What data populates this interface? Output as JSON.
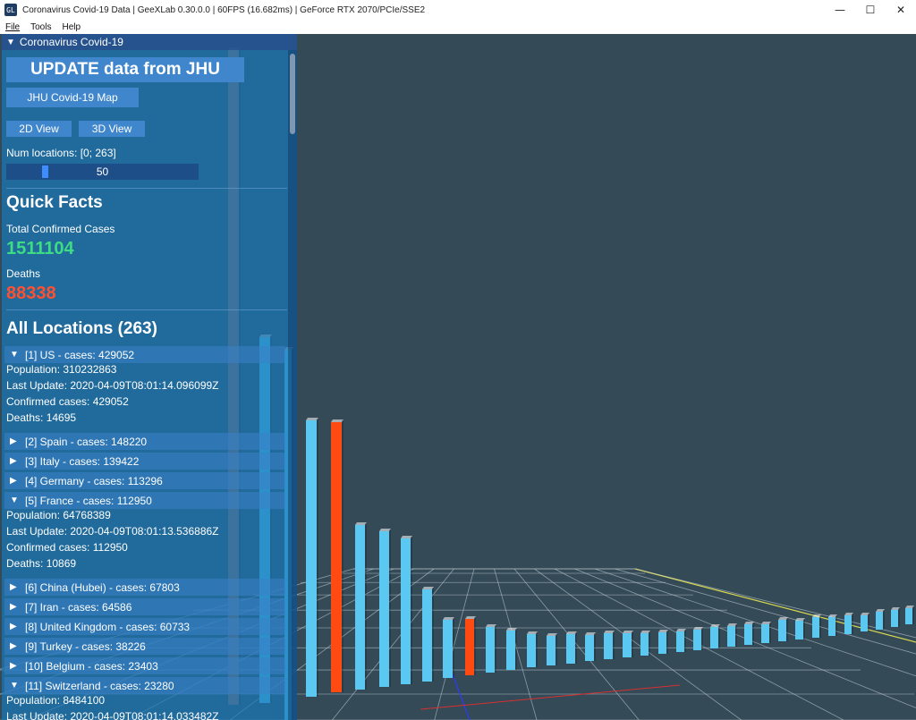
{
  "window": {
    "title": "Coronavirus Covid-19 Data | GeeXLab 0.30.0.0 | 60FPS (16.682ms) | GeForce RTX 2070/PCIe/SSE2",
    "app_icon": "GL",
    "controls": {
      "minimize": "—",
      "maximize": "☐",
      "close": "✕"
    }
  },
  "menubar": [
    "File",
    "Tools",
    "Help"
  ],
  "panel": {
    "header": "Coronavirus Covid-19",
    "update_button": "UPDATE data from JHU",
    "map_button": "JHU Covid-19 Map",
    "view_2d_button": "2D View",
    "view_3d_button": "3D View",
    "num_locations_label": "Num locations: [0; 263]",
    "num_locations_value": "50",
    "num_locations_fraction": 0.19,
    "quick_facts_title": "Quick Facts",
    "total_confirmed_label": "Total Confirmed Cases",
    "total_confirmed_value": "1511104",
    "deaths_label": "Deaths",
    "deaths_value": "88338",
    "all_locations_title": "All Locations (263)"
  },
  "locations": [
    {
      "label": "[1] US - cases: 429052",
      "expanded": true,
      "details": [
        "Population: 310232863",
        "Last Update: 2020-04-09T08:01:14.096099Z",
        "Confirmed cases: 429052",
        "Deaths: 14695"
      ]
    },
    {
      "label": "[2] Spain - cases: 148220",
      "expanded": false
    },
    {
      "label": "[3] Italy - cases: 139422",
      "expanded": false
    },
    {
      "label": "[4] Germany - cases: 113296",
      "expanded": false
    },
    {
      "label": "[5] France - cases: 112950",
      "expanded": true,
      "details": [
        "Population: 64768389",
        "Last Update: 2020-04-09T08:01:13.536886Z",
        "Confirmed cases: 112950",
        "Deaths: 10869"
      ]
    },
    {
      "label": "[6] China (Hubei) - cases: 67803",
      "expanded": false
    },
    {
      "label": "[7] Iran - cases: 64586",
      "expanded": false
    },
    {
      "label": "[8] United Kingdom - cases: 60733",
      "expanded": false
    },
    {
      "label": "[9] Turkey - cases: 38226",
      "expanded": false
    },
    {
      "label": "[10] Belgium - cases: 23403",
      "expanded": false
    },
    {
      "label": "[11] Switzerland - cases: 23280",
      "expanded": true,
      "details": [
        "Population: 8484100",
        "Last Update: 2020-04-09T08:01:14.033482Z"
      ]
    }
  ],
  "colors": {
    "viewport_bg": "#344a57",
    "bar_cyan": "#5ac8f0",
    "bar_orange": "#ff4a12",
    "bar_brown": "#8c6a60",
    "grid": "#c8d2d8",
    "grid_edge": "#d8d850",
    "confirmed_green": "#3ddc84",
    "deaths_red": "#ff5030"
  }
}
